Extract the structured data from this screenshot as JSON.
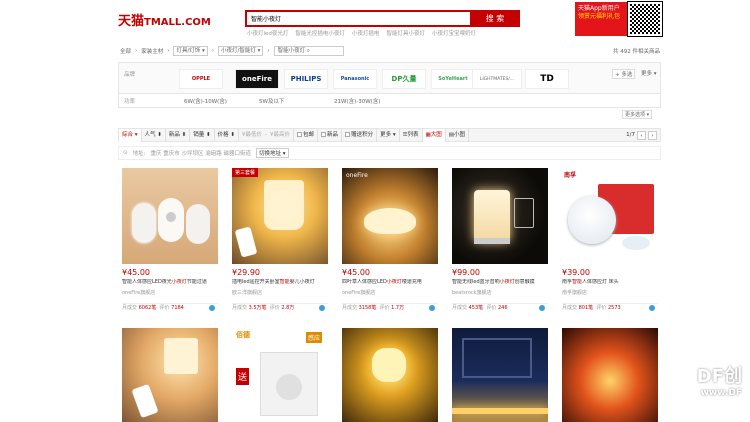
{
  "header": {
    "logo_cn": "天猫",
    "logo_en": "TMALL.COM",
    "search_value": "智能小夜灯",
    "search_button": "搜 索",
    "hot_words": [
      "小夜灯led夜光灯",
      "智能光控插电小夜灯",
      "小夜灯插电",
      "智能灯具小夜灯",
      "小夜灯宝宝喂奶灯"
    ],
    "promo_line1": "天猫App新用户",
    "promo_line2": "领赏元福利礼包"
  },
  "crumbs": {
    "all": "全部",
    "cat1": "家装主材",
    "cat2": "灯具/灯饰",
    "cat3": "小夜灯/智能灯",
    "query": "智能小夜灯",
    "total": "共 492 件相关商品"
  },
  "brand_panel": {
    "label": "品牌",
    "brands": [
      "OPPLE",
      "oneFire",
      "PHILIPS",
      "Panasonic",
      "DP久量",
      "SoYeHeart",
      "LIGHTMATES/...",
      "TD"
    ],
    "multi": "多选",
    "more": "更多"
  },
  "spec_row": {
    "label": "功率",
    "values": [
      "6W(含)-10W(含)",
      "5W及以下",
      "21W(含)-30W(含)"
    ],
    "more_options": "更多选项"
  },
  "sort_bar": {
    "items": [
      "综合",
      "人气",
      "新品",
      "销量",
      "价格"
    ],
    "price_from": "¥最低价",
    "price_to": "¥最高价",
    "filters": [
      "包邮",
      "新品",
      "赠送积分"
    ],
    "more": "更多",
    "view_list": "列表",
    "view_grid": "大图",
    "view_small": "小图",
    "page": "1/7"
  },
  "location": {
    "label": "地址:",
    "value": "重庆 重庆市 沙坪坝区 渝碚路 磁器口街道",
    "button": "切换地址"
  },
  "products": [
    {
      "price": "¥45.00",
      "title_pre": "智能人体感应LED夜光",
      "title_hl": "小夜灯",
      "title_post": "节能过道",
      "shop": "oneFire旗舰店",
      "sales": "6062笔",
      "reviews": "7184",
      "tag": ""
    },
    {
      "price": "¥29.90",
      "title_pre": "插电led遥控开关卧室",
      "title_hl": "智能",
      "title_post": "婴儿小夜灯",
      "shop": "欧三洋旗舰店",
      "sales": "3.5万笔",
      "reviews": "2.8万",
      "tag": "第三套餐"
    },
    {
      "price": "¥45.00",
      "title_pre": "四叶草人体感应LED",
      "title_hl": "小夜灯",
      "title_post": "楼道充电",
      "shop": "oneFire旗舰店",
      "sales": "3158笔",
      "reviews": "1.7万",
      "tag": ""
    },
    {
      "price": "¥99.00",
      "title_pre": "智能无线led蓝牙音响",
      "title_hl": "小夜灯",
      "title_post": "创意触摸",
      "shop": "beatsrock旗舰店",
      "sales": "453笔",
      "reviews": "246",
      "tag": ""
    },
    {
      "price": "¥39.00",
      "title_pre": "南孚",
      "title_hl": "智能",
      "title_post": "人体感应灯 床头",
      "shop": "南孚旗舰店",
      "sales": "801笔",
      "reviews": "2573",
      "tag": ""
    }
  ],
  "row2_labels": {
    "brand_b": "佰德",
    "badge_b": "感应",
    "send": "送"
  },
  "stats_labels": {
    "sales": "月成交",
    "reviews": "评价"
  },
  "watermark": {
    "main": "DF创",
    "sub": "www.DF"
  }
}
